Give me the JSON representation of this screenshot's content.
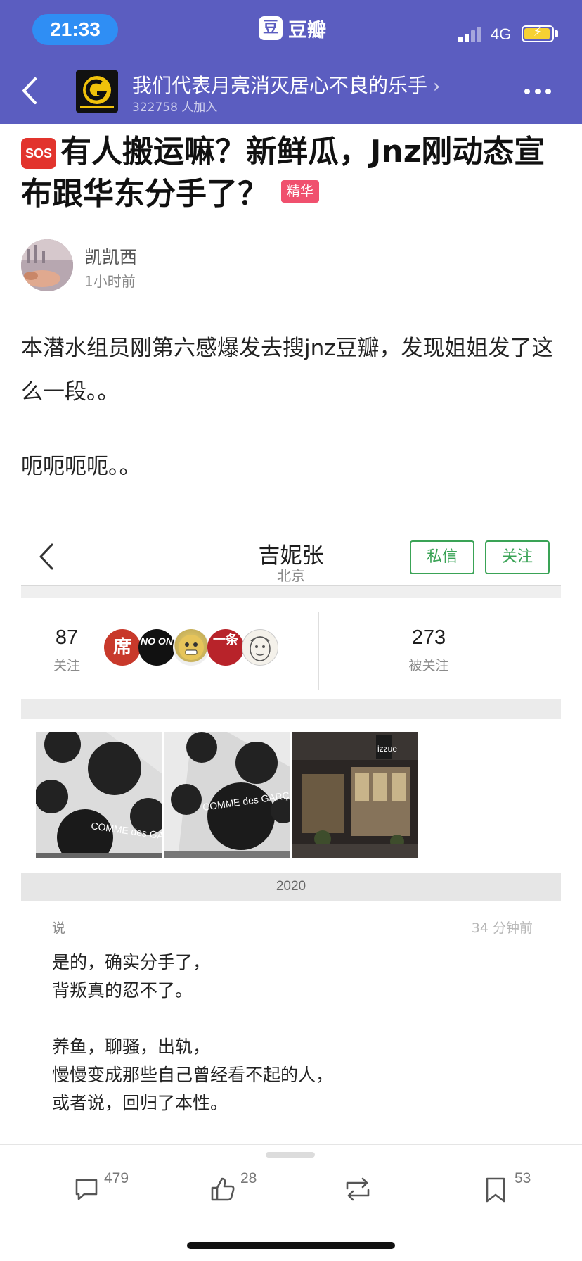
{
  "status_bar": {
    "time": "21:33",
    "network": "4G",
    "app_name": "豆瓣",
    "app_logo_char": "豆"
  },
  "group": {
    "name": "我们代表月亮消灭居心不良的乐手",
    "members": "322758 人加入"
  },
  "post": {
    "sos_label": "SOS",
    "title": "有人搬运嘛？新鲜瓜，Jnz刚动态宣布跟华东分手了？",
    "badge": "精华",
    "author": "凯凯西",
    "time": "1小时前",
    "body": [
      "本潜水组员刚第六感爆发去搜jnz豆瓣，发现姐姐发了这么一段。。",
      "呃呃呃呃。。"
    ]
  },
  "embedded_profile": {
    "name": "吉妮张",
    "location": "北京",
    "message_button": "私信",
    "follow_button": "关注",
    "following_count": "87",
    "following_label": "关注",
    "followers_count": "273",
    "followers_label": "被关注",
    "friend_avatars": [
      {
        "icon": "seal-xi-avatar",
        "text": "席"
      },
      {
        "icon": "no-on-avatar",
        "text": "NO ON"
      },
      {
        "icon": "golden-face-avatar",
        "text": ""
      },
      {
        "icon": "yitiao-avatar",
        "text": "一条"
      },
      {
        "icon": "sketch-face-avatar",
        "text": ""
      }
    ],
    "photos": [
      {
        "icon": "comme-des-garcons-building-photo",
        "caption": "COMME des GARÇO"
      },
      {
        "icon": "comme-des-garcons-building-photo",
        "caption": "COMME des GARÇ"
      },
      {
        "icon": "izzue-storefront-photo",
        "caption": "izzue"
      }
    ],
    "year": "2020",
    "status_label": "说",
    "status_time": "34 分钟前",
    "status_lines": [
      "是的，确实分手了，",
      "背叛真的忍不了。",
      "",
      "养鱼，聊骚，出轨，",
      "慢慢变成那些自己曾经看不起的人，",
      "或者说，回归了本性。"
    ]
  },
  "actions": {
    "comments": "479",
    "likes": "28",
    "saves": "53"
  },
  "colors": {
    "header_bg": "#5b5dc0",
    "accent_green": "#3aa356",
    "badge_pink": "#f0506e",
    "sos_red": "#e2342d"
  }
}
